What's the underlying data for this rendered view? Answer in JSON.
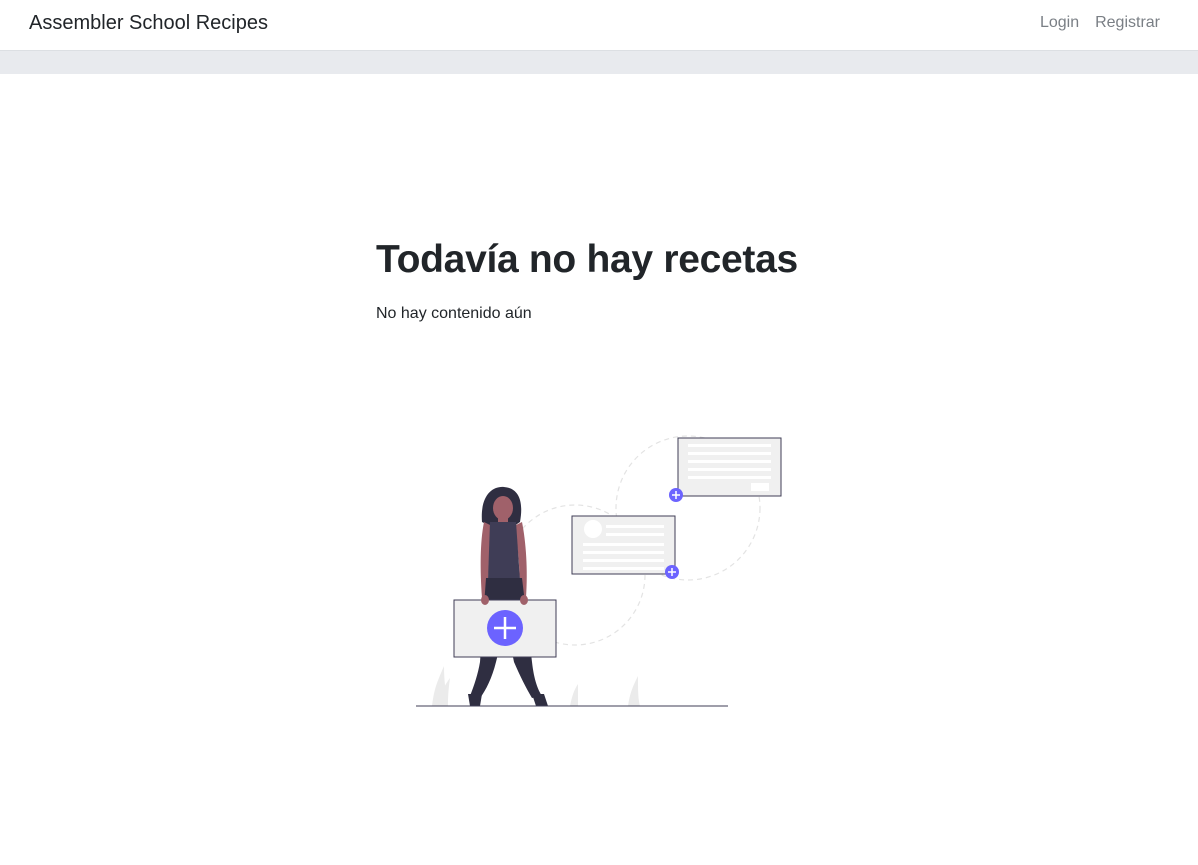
{
  "navbar": {
    "brand": "Assembler School Recipes",
    "links": [
      {
        "label": "Login"
      },
      {
        "label": "Registrar"
      }
    ]
  },
  "empty_state": {
    "title": "Todavía no hay recetas",
    "message": "No hay contenido aún",
    "illustration_icon": "empty-recipes-illustration"
  },
  "colors": {
    "accent": "#6c63ff",
    "navbar_bg": "#ffffff",
    "subbar_bg": "#e8eaee",
    "link_muted": "#7a7f85",
    "text": "#212529"
  }
}
